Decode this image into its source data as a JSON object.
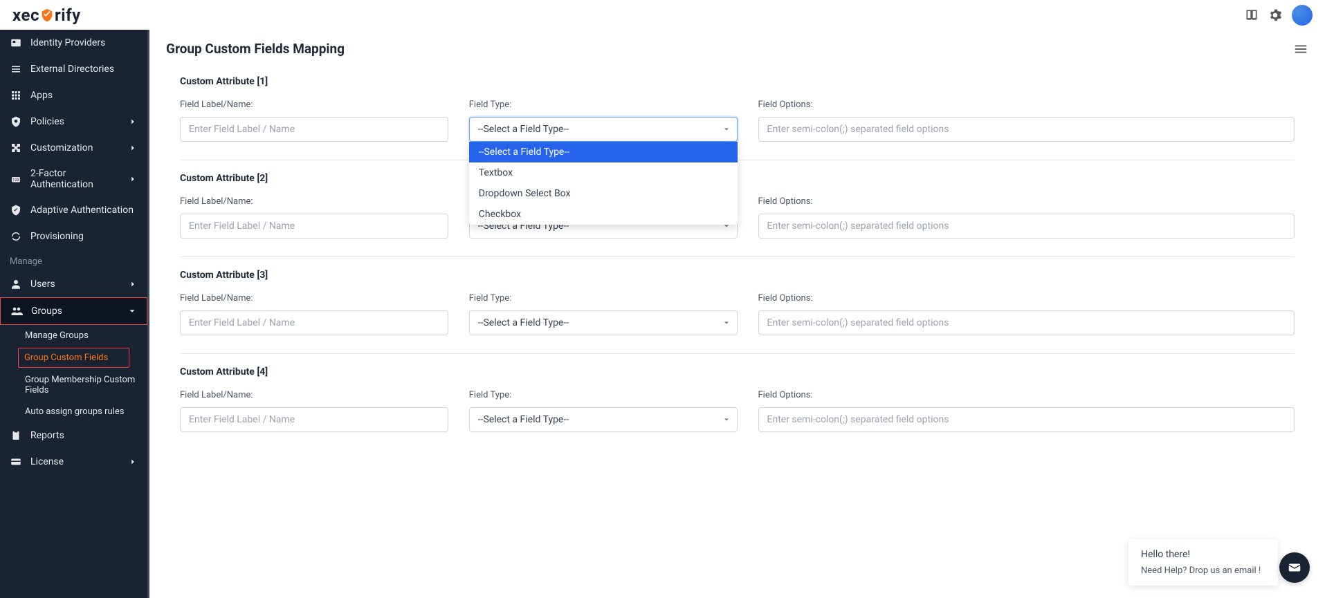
{
  "brand": {
    "pre": "xec",
    "post": "rify"
  },
  "header": {
    "book_icon": "book-icon",
    "gear_icon": "gear-icon",
    "avatar": "user-avatar"
  },
  "sidebar": {
    "items": [
      {
        "label": "Identity Providers",
        "icon": "id-icon",
        "expandable": false
      },
      {
        "label": "External Directories",
        "icon": "list-icon",
        "expandable": false
      },
      {
        "label": "Apps",
        "icon": "grid-icon",
        "expandable": false
      },
      {
        "label": "Policies",
        "icon": "shield-cog-icon",
        "expandable": true
      },
      {
        "label": "Customization",
        "icon": "puzzle-icon",
        "expandable": true
      },
      {
        "label": "2-Factor Authentication",
        "icon": "badge-icon",
        "expandable": true
      },
      {
        "label": "Adaptive Authentication",
        "icon": "shield-check-icon",
        "expandable": false
      },
      {
        "label": "Provisioning",
        "icon": "sync-icon",
        "expandable": false
      }
    ],
    "manage_label": "Manage",
    "manage_items": [
      {
        "label": "Users",
        "icon": "user-icon",
        "expandable": true
      },
      {
        "label": "Groups",
        "icon": "groups-icon",
        "expandable": true,
        "active": true
      }
    ],
    "group_sub": [
      {
        "label": "Manage Groups"
      },
      {
        "label": "Group Custom Fields",
        "highlighted": true
      },
      {
        "label": "Group Membership Custom Fields"
      },
      {
        "label": "Auto assign groups rules"
      }
    ],
    "bottom_items": [
      {
        "label": "Reports",
        "icon": "clipboard-icon",
        "expandable": false
      },
      {
        "label": "License",
        "icon": "card-icon",
        "expandable": true
      }
    ]
  },
  "page": {
    "title": "Group Custom Fields Mapping"
  },
  "labels": {
    "field_label": "Field Label/Name:",
    "field_type": "Field Type:",
    "field_options": "Field Options:",
    "placeholder_label": "Enter Field Label / Name",
    "placeholder_options": "Enter semi-colon(;) separated field options",
    "select_placeholder": "--Select a Field Type--"
  },
  "attributes": [
    {
      "title": "Custom Attribute [1]",
      "dropdown_open": true
    },
    {
      "title": "Custom Attribute [2]",
      "dropdown_open": false
    },
    {
      "title": "Custom Attribute [3]",
      "dropdown_open": false
    },
    {
      "title": "Custom Attribute [4]",
      "dropdown_open": false
    }
  ],
  "field_type_options": [
    "--Select a Field Type--",
    "Textbox",
    "Dropdown Select Box",
    "Checkbox"
  ],
  "chat": {
    "line1": "Hello there!",
    "line2": "Need Help? Drop us an email !"
  }
}
